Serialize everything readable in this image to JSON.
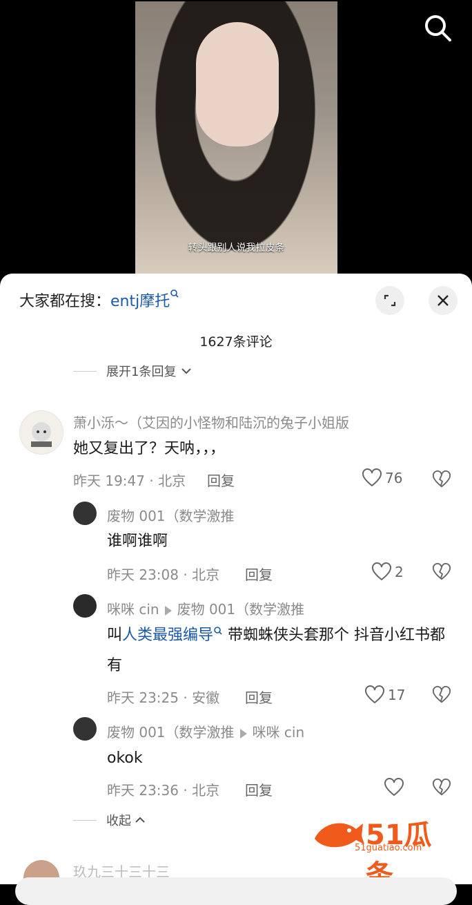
{
  "video": {
    "subtitle": "转头跟别人说我拉皮条"
  },
  "search_header": {
    "prefix": "大家都在搜：",
    "keyword": "entj摩托"
  },
  "comment_count": "1627条评论",
  "expand_reply": "展开1条回复",
  "comments": [
    {
      "user": "萧小泺～（艾因的小怪物和陆沉的兔子小姐版",
      "text": "她又复出了？天呐，，，",
      "time": "昨天 19:47 · 北京",
      "reply": "回复",
      "likes": "76"
    }
  ],
  "replies": [
    {
      "user": "废物 001（数学激推",
      "text": "谁啊谁啊",
      "time": "昨天 23:08 · 北京",
      "reply": "回复",
      "likes": "2"
    },
    {
      "user": "咪咪 cin",
      "to": "废物 001（数学激推",
      "text_before": "叫",
      "keyword": "人类最强编导",
      "text_after": " 带蜘蛛侠头套那个 抖音小红书都有",
      "time": "昨天 23:25 · 安徽",
      "reply": "回复",
      "likes": "17"
    },
    {
      "user": "废物 001（数学激推",
      "to": "咪咪 cin",
      "text": "okok",
      "time": "昨天 23:36 · 北京",
      "reply": "回复",
      "likes": ""
    }
  ],
  "collapse": "收起",
  "next_user": "玖九三十三十三",
  "watermark": {
    "brand": "51瓜条",
    "url": "51guatiao.com",
    "color": "#f05a1a"
  }
}
